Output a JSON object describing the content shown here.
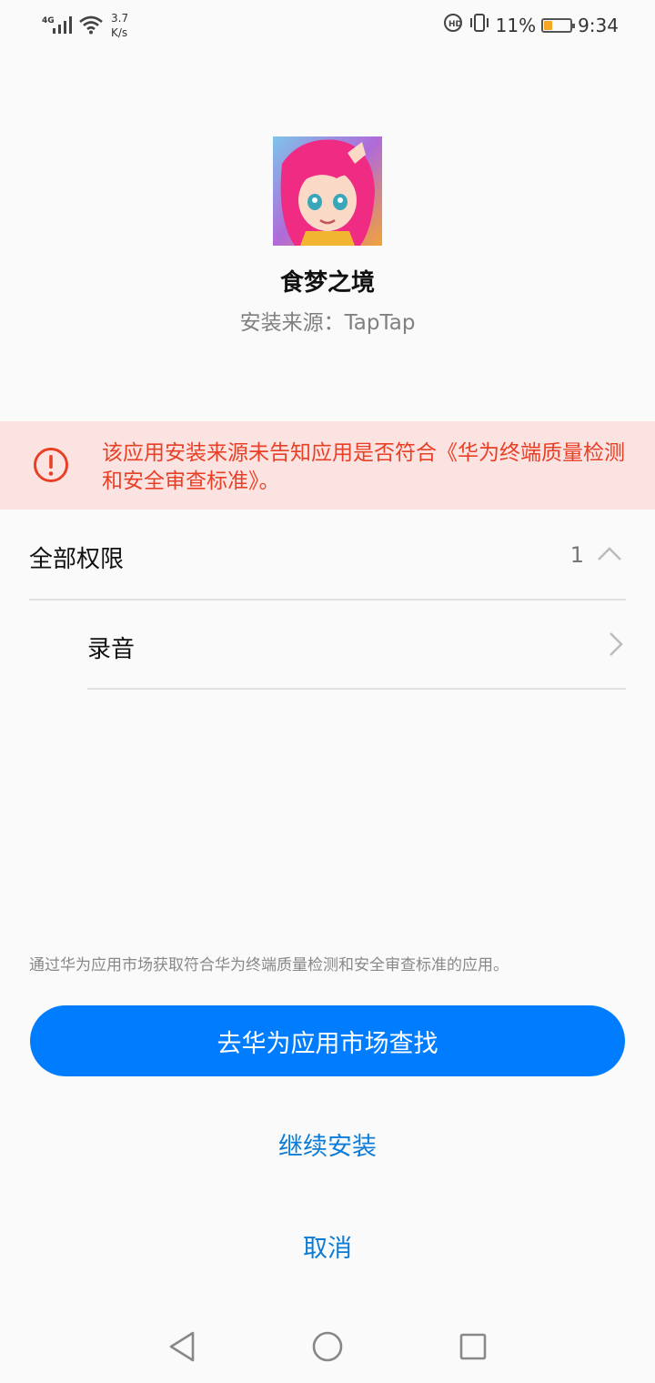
{
  "status_bar": {
    "network_type": "4G",
    "net_speed_value": "3.7",
    "net_speed_unit": "K/s",
    "battery_percent": "11%",
    "time": "9:34",
    "battery_level": 0.11,
    "battery_color": "#f5a623",
    "icons": [
      "signal-icon",
      "wifi-icon",
      "hd-call-icon",
      "vibrate-icon",
      "battery-icon"
    ]
  },
  "app": {
    "name": "食梦之境",
    "source": "安装来源：TapTap"
  },
  "warning": {
    "text": "该应用安装来源未告知应用是否符合《华为终端质量检测和安全审查标准》。",
    "color": "#e84026",
    "background": "#fbe3e1"
  },
  "permissions": {
    "header": "全部权限",
    "count": "1",
    "items": [
      {
        "label": "录音"
      }
    ]
  },
  "footer": {
    "hint": "通过华为应用市场获取符合华为终端质量检测和安全审查标准的应用。",
    "primary_button": "去华为应用市场查找",
    "continue_button": "继续安装",
    "cancel_button": "取消",
    "accent_color": "#007dff"
  },
  "nav_bar": {
    "icons": [
      "back-icon",
      "home-icon",
      "recents-icon"
    ]
  }
}
